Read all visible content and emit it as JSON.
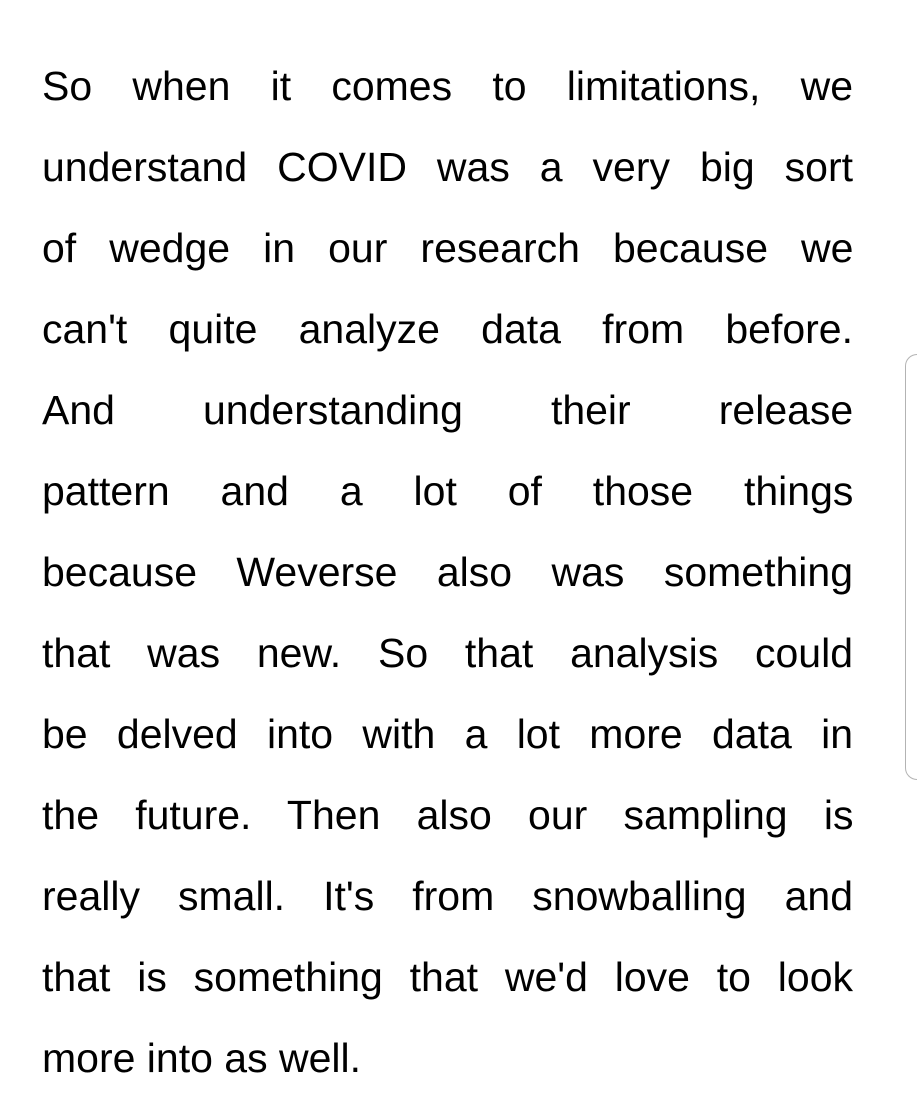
{
  "document": {
    "lines": [
      "So when it comes to limitations, we",
      "understand COVID was a very big sort",
      "of wedge in our research because we",
      "can't quite analyze data from before.",
      "And understanding their release",
      "pattern and a lot of those things",
      "because Weverse also was something",
      "that was new. So that analysis could",
      "be delved into with a lot more data in",
      "the future. Then also our sampling is",
      "really small. It's from snowballing and",
      "that is something that we'd love to look",
      "more into as well."
    ]
  },
  "colors": {
    "text": "#000000",
    "background": "#ffffff",
    "scroll_handle": "#b3b3b3"
  }
}
